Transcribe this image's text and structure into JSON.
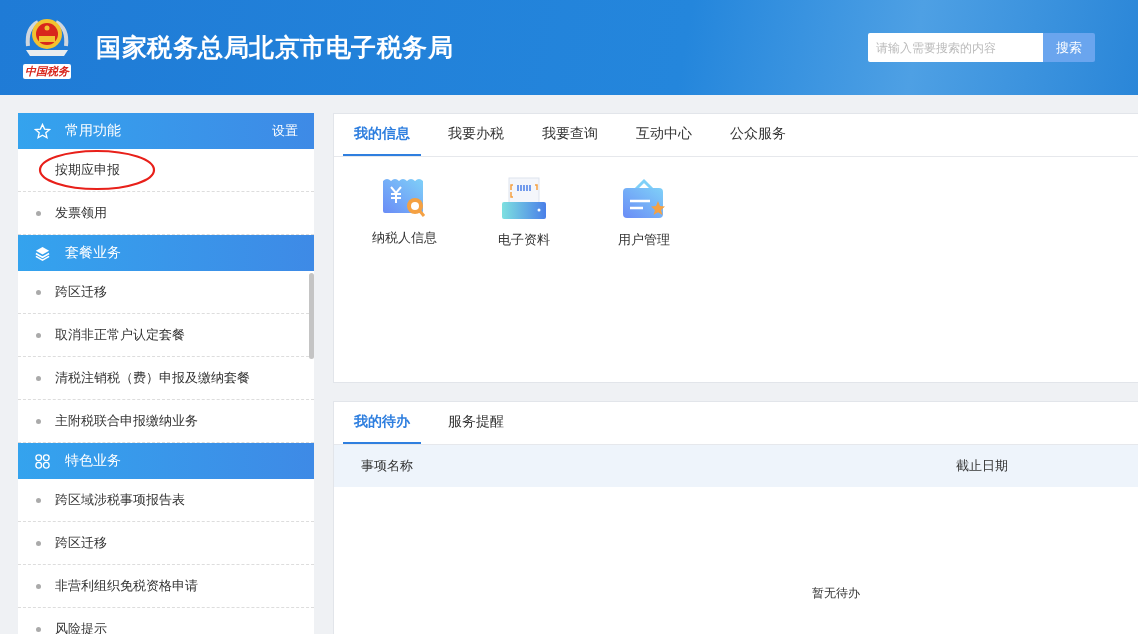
{
  "header": {
    "title": "国家税务总局北京市电子税务局",
    "logo_caption": "中国税务",
    "search": {
      "placeholder": "请输入需要搜索的内容",
      "button": "搜索"
    }
  },
  "sidebar": {
    "sections": [
      {
        "kind": "star",
        "title": "常用功能",
        "action": "设置",
        "scrollbar": false,
        "items": [
          {
            "label": "按期应申报",
            "bullet": false,
            "circled": true
          },
          {
            "label": "发票领用",
            "bullet": true,
            "circled": false
          }
        ]
      },
      {
        "kind": "layers",
        "title": "套餐业务",
        "scrollbar": true,
        "items": [
          {
            "label": "跨区迁移",
            "bullet": true,
            "circled": false
          },
          {
            "label": "取消非正常户认定套餐",
            "bullet": true,
            "circled": false
          },
          {
            "label": "清税注销税（费）申报及缴纳套餐",
            "bullet": true,
            "circled": false
          },
          {
            "label": "主附税联合申报缴纳业务",
            "bullet": true,
            "circled": false
          }
        ]
      },
      {
        "kind": "grid",
        "title": "特色业务",
        "scrollbar": false,
        "items": [
          {
            "label": "跨区域涉税事项报告表",
            "bullet": true,
            "circled": false
          },
          {
            "label": "跨区迁移",
            "bullet": true,
            "circled": false
          },
          {
            "label": "非营利组织免税资格申请",
            "bullet": true,
            "circled": false
          },
          {
            "label": "风险提示",
            "bullet": true,
            "circled": false
          }
        ]
      }
    ]
  },
  "info_panel": {
    "tabs": [
      {
        "label": "我的信息",
        "selected": true
      },
      {
        "label": "我要办税",
        "selected": false
      },
      {
        "label": "我要查询",
        "selected": false
      },
      {
        "label": "互动中心",
        "selected": false
      },
      {
        "label": "公众服务",
        "selected": false
      }
    ],
    "tiles": [
      {
        "kind": "receipt",
        "label": "纳税人信息"
      },
      {
        "kind": "printer",
        "label": "电子资料"
      },
      {
        "kind": "card",
        "label": "用户管理"
      }
    ]
  },
  "todo_panel": {
    "tabs": [
      {
        "label": "我的待办",
        "selected": true
      },
      {
        "label": "服务提醒",
        "selected": false
      }
    ],
    "columns": [
      "事项名称",
      "截止日期"
    ],
    "empty_text": "暂无待办"
  }
}
